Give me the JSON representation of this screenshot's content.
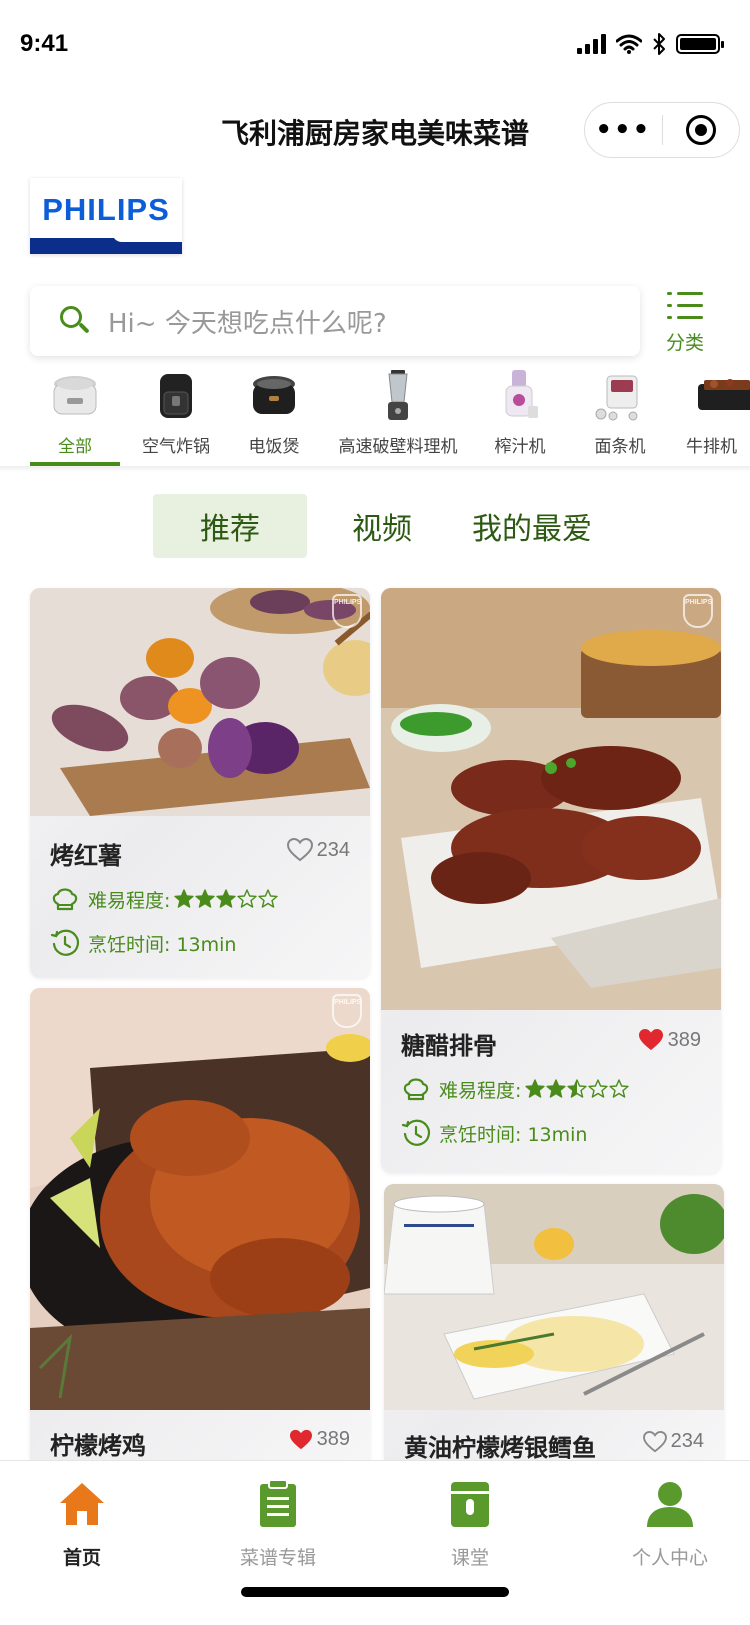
{
  "status_bar": {
    "time": "9:41"
  },
  "navbar": {
    "title": "飞利浦厨房家电美味菜谱",
    "more_label": "•••"
  },
  "logo": {
    "text": "PHILIPS"
  },
  "search": {
    "placeholder": "Hi~ 今天想吃点什么呢?"
  },
  "category_button": {
    "label": "分类"
  },
  "appliances": [
    {
      "label": "全部",
      "icon": "rice-cooker-icon",
      "active": true
    },
    {
      "label": "空气炸锅",
      "icon": "air-fryer-icon"
    },
    {
      "label": "电饭煲",
      "icon": "rice-cooker-black-icon"
    },
    {
      "label": "高速破壁料理机",
      "icon": "blender-icon"
    },
    {
      "label": "榨汁机",
      "icon": "juicer-icon"
    },
    {
      "label": "面条机",
      "icon": "noodle-maker-icon"
    },
    {
      "label": "牛排机",
      "icon": "grill-icon"
    }
  ],
  "segments": [
    {
      "label": "推荐",
      "active": true
    },
    {
      "label": "视频"
    },
    {
      "label": "我的最爱"
    }
  ],
  "recipes": [
    {
      "title": "烤红薯",
      "likes": "234",
      "liked": false,
      "difficulty_label": "难易程度:",
      "difficulty": 3,
      "time_label": "烹饪时间: 13min"
    },
    {
      "title": "糖醋排骨",
      "likes": "389",
      "liked": true,
      "difficulty_label": "难易程度:",
      "difficulty": 2.5,
      "time_label": "烹饪时间: 13min"
    },
    {
      "title": "柠檬烤鸡",
      "likes": "389",
      "liked": true
    },
    {
      "title": "黄油柠檬烤银鳕鱼",
      "likes": "234",
      "liked": false
    }
  ],
  "tabbar": [
    {
      "label": "首页",
      "icon": "home-icon",
      "active": true
    },
    {
      "label": "菜谱专辑",
      "icon": "clipboard-icon"
    },
    {
      "label": "课堂",
      "icon": "classroom-icon"
    },
    {
      "label": "个人中心",
      "icon": "person-icon"
    }
  ],
  "colors": {
    "brand_green": "#4a8c1c",
    "philips_blue": "#0b5ed7",
    "home_orange": "#e8781a",
    "heart_red": "#e0282e"
  },
  "watermark_text": "PHILIPS"
}
